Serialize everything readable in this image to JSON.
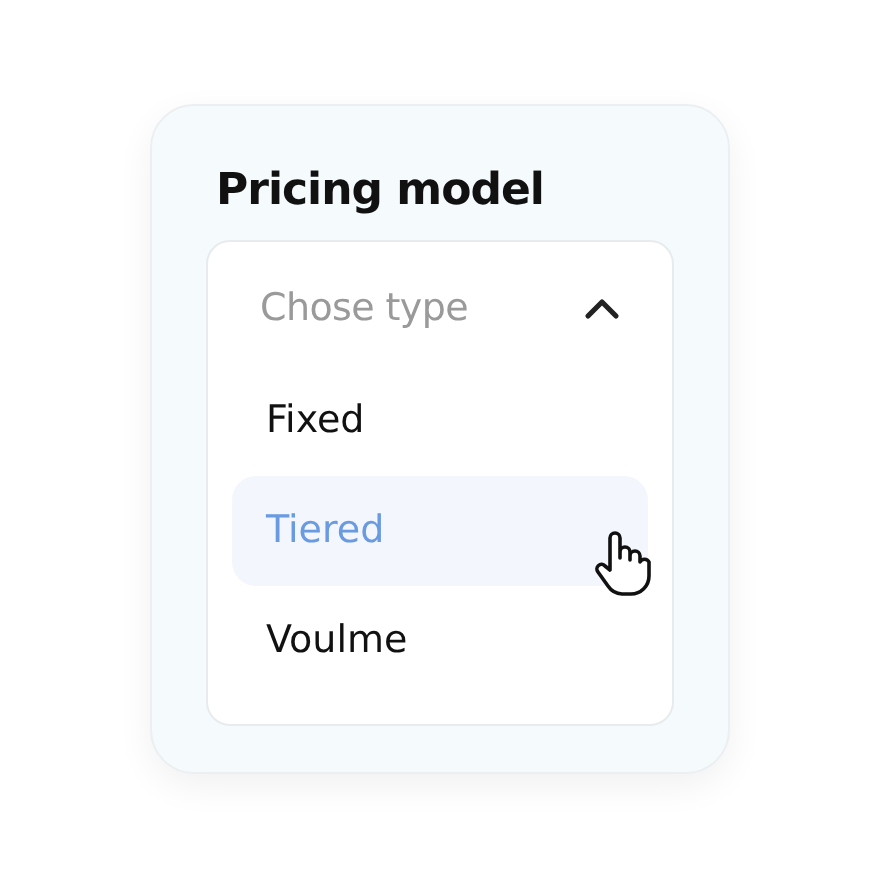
{
  "title": "Pricing model",
  "dropdown": {
    "placeholder": "Chose type",
    "expanded": true,
    "options": [
      {
        "label": "Fixed",
        "selected": false
      },
      {
        "label": "Tiered",
        "selected": true
      },
      {
        "label": "Voulme",
        "selected": false
      }
    ]
  }
}
